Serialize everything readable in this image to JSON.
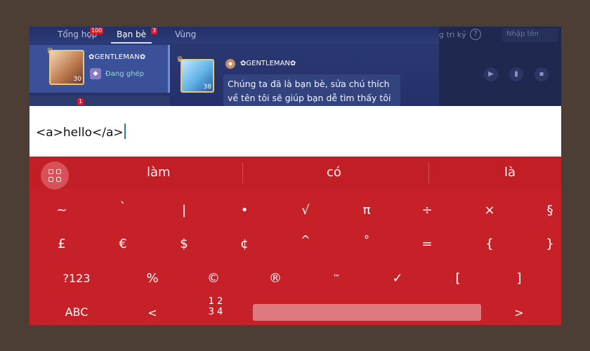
{
  "game": {
    "tabs": [
      {
        "label": "Tổng hợp",
        "badge": "100"
      },
      {
        "label": "Bạn bè",
        "badge": "3"
      },
      {
        "label": "Vùng"
      }
    ],
    "right_panel": {
      "label": "g tri kỷ",
      "help": "?",
      "input_placeholder": "Nhập tên"
    },
    "friend": {
      "name": "✿GENTLEMAN✿",
      "status": "Đang ghép",
      "level": "30"
    },
    "message": {
      "sender": "✿GENTLEMAN✿",
      "level": "38",
      "line1": "Chúng ta đã là bạn bè, sửa chú thích",
      "line2": "về tên tôi sẽ giúp bạn dễ tìm thấy tôi"
    },
    "friend2_badge": "1"
  },
  "input": {
    "text": "<a>hello</a>"
  },
  "keyboard": {
    "suggestions": [
      "làm",
      "có",
      "là"
    ],
    "row1": [
      "~",
      "`",
      "|",
      "•",
      "√",
      "π",
      "÷",
      "×",
      "§"
    ],
    "row2": [
      "£",
      "€",
      "$",
      "¢",
      "^",
      "°",
      "=",
      "{",
      "}"
    ],
    "row3": [
      "?123",
      "%",
      "©",
      "®",
      "™",
      "✓",
      "[",
      "]"
    ],
    "row4": {
      "abc": "ABC",
      "lt": "<",
      "page_top": "1 2",
      "page_bottom": "3 4",
      "gt": ">"
    }
  },
  "colors": {
    "keyboard": "#c62028",
    "frame": "#4c3e35",
    "caret": "#1f8a78"
  }
}
